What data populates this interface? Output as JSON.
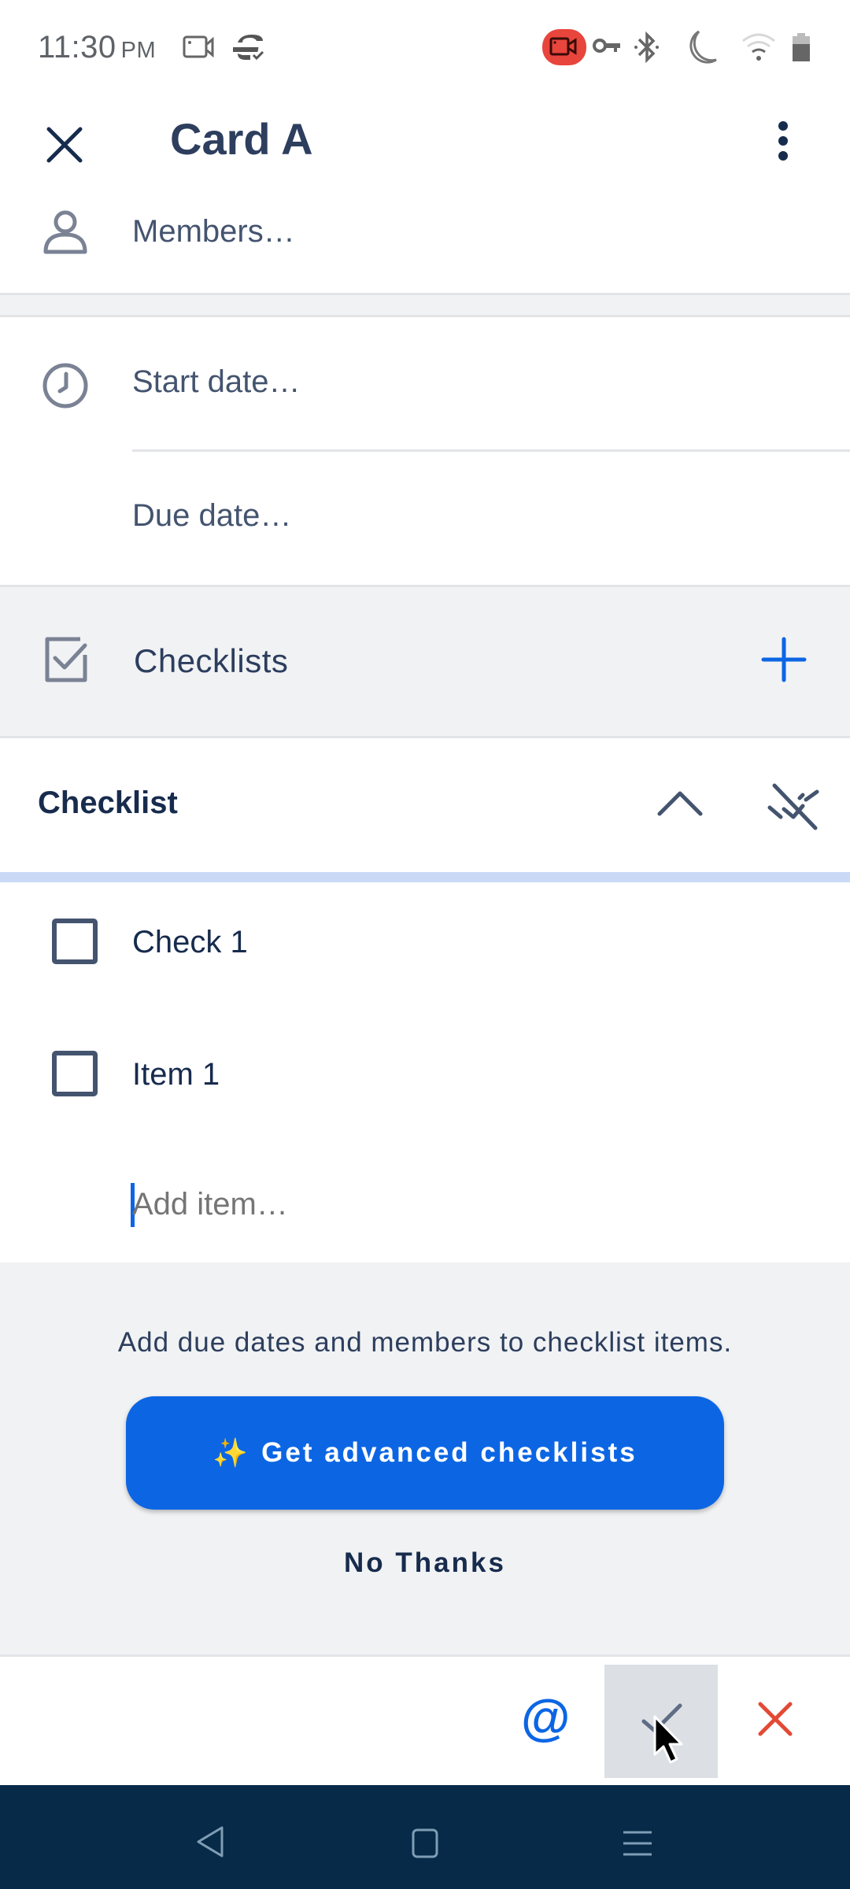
{
  "status_bar": {
    "time": "11:30",
    "ampm": "PM",
    "left_icons": [
      "screen-record-icon",
      "sync-check-icon"
    ],
    "right_icons": [
      "video-recording-icon",
      "vpn-key-icon",
      "bluetooth-icon",
      "do-not-disturb-moon-icon",
      "wifi-icon",
      "battery-icon"
    ],
    "recording_color": "#e8453c"
  },
  "header": {
    "title": "Card A",
    "close_icon": "close-icon",
    "menu_icon": "more-vertical-icon"
  },
  "fields": {
    "members": "Members…",
    "start_date": "Start date…",
    "due_date": "Due date…"
  },
  "checklists_section": {
    "label": "Checklists",
    "add_icon": "plus-icon"
  },
  "checklist": {
    "title": "Checklist",
    "progress": 0,
    "items": [
      {
        "label": "Check 1",
        "checked": false
      },
      {
        "label": "Item 1",
        "checked": false
      }
    ],
    "add_item_placeholder": "Add item…",
    "add_item_value": ""
  },
  "promo": {
    "text": "Add due dates and members to checklist items.",
    "button_icon": "✨",
    "button_label": "Get advanced checklists",
    "dismiss_label": "No Thanks"
  },
  "edit_toolbar": {
    "mention_label": "@",
    "confirm_icon": "check-icon",
    "cancel_icon": "close-icon"
  },
  "colors": {
    "accent": "#0c66e4",
    "danger": "#e34935",
    "text_primary": "#172b4d",
    "nav_bar": "#062a47"
  }
}
